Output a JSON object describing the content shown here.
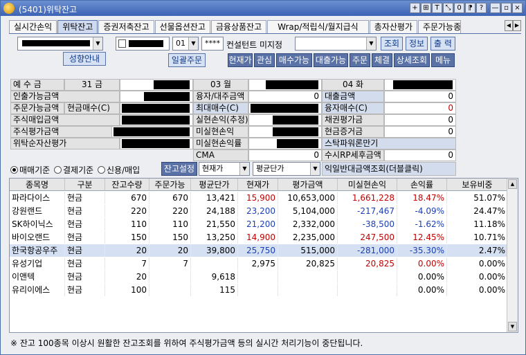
{
  "window": {
    "title": "(5401)위탁잔고",
    "title_buttons": [
      "+",
      "⊞",
      "T",
      "⤡",
      "0",
      "⁋",
      "?",
      "—",
      "▫",
      "×"
    ]
  },
  "tabs": [
    "실시간손익",
    "위탁잔고",
    "증권저축잔고",
    "선물옵션잔고",
    "금융상품잔고",
    "Wrap/적립식/월지급식",
    "총자산평가",
    "주문가능종합"
  ],
  "tab_nav": {
    "prev": "◀",
    "next": "▶"
  },
  "toolbar": {
    "account_suffix": "01",
    "password_mask": "****",
    "consultant_label": "컨설턴트 미지정",
    "query": "조회",
    "info": "정보",
    "print": "출 력",
    "propensity": "성향안내",
    "batch_order": "일괄주문",
    "current_price": "현재가",
    "interest": "관심",
    "buy_possible": "매수가능",
    "loan_possible": "대출가능",
    "order": "주문",
    "execution": "체결",
    "detail_query": "상세조회",
    "menu": "메뉴"
  },
  "dates": {
    "deposit_label": "예 수 금",
    "d0": "31 금",
    "d1": "03 월",
    "d2": "04 화"
  },
  "summary": {
    "rows": [
      {
        "l1": "인출가능금액",
        "l2": "융자/대주금액",
        "v2": "0",
        "l3": "대출금액",
        "v3": "0"
      },
      {
        "l1": "주문가능금액",
        "l1b": "현금매수(C)",
        "l2": "최대매수(C)",
        "l3": "융자매수(C)",
        "v3": "0"
      },
      {
        "l1": "주식매입금액",
        "l2": "실현손익(추정)",
        "l3": "채권평가금",
        "v3": "0"
      },
      {
        "l1": "주식평가금액",
        "l2": "미실현손익",
        "l3": "현금증거금",
        "v3": "0"
      },
      {
        "l1": "위탁순자산평가",
        "l2": "미실현손익률",
        "l3": "스탁파워론만기"
      },
      {
        "l2": "CMA",
        "v2": "0",
        "l3": "수시RP세후금액",
        "v3": "0"
      }
    ]
  },
  "options": {
    "radio_buy": "매매기준",
    "radio_settle": "결제기준",
    "radio_credit": "신용/매입",
    "balance_setting": "잔고설정",
    "price_select": "현재가",
    "avg_select": "평균단가",
    "pnl_note": "익일반대금액조회(더블클릭)"
  },
  "table": {
    "headers": [
      "종목명",
      "구분",
      "잔고수량",
      "주문가능",
      "평균단가",
      "현재가",
      "평가금액",
      "미실현손익",
      "손익률",
      "보유비중"
    ],
    "rows": [
      [
        "파라다이스",
        "현금",
        "670",
        "670",
        "13,421",
        "15,900",
        "10,653,000",
        "1,661,228",
        "18.47%",
        "51.07%"
      ],
      [
        "강원랜드",
        "현금",
        "220",
        "220",
        "24,188",
        "23,200",
        "5,104,000",
        "-217,467",
        "-4.09%",
        "24.47%"
      ],
      [
        "SK하이닉스",
        "현금",
        "110",
        "110",
        "21,550",
        "21,200",
        "2,332,000",
        "-38,500",
        "-1.62%",
        "11.18%"
      ],
      [
        "바이오랜드",
        "현금",
        "150",
        "150",
        "13,250",
        "14,900",
        "2,235,000",
        "247,500",
        "12.45%",
        "10.71%"
      ],
      [
        "한국항공우주",
        "현금",
        "20",
        "20",
        "39,800",
        "25,750",
        "515,000",
        "-281,000",
        "-35.30%",
        "2.47%"
      ],
      [
        "유성기업",
        "현금",
        "7",
        "7",
        "",
        "2,975",
        "20,825",
        "20,825",
        "0.00%",
        "0.00%"
      ],
      [
        "이앤텍",
        "현금",
        "20",
        "",
        "9,618",
        "",
        "",
        "",
        "0.00%",
        "0.00%"
      ],
      [
        "유리이에스",
        "현금",
        "100",
        "",
        "115",
        "",
        "",
        "",
        "0.00%",
        "0.00%"
      ]
    ],
    "colors": {
      "up": "#c00000",
      "down": "#1a3fb5",
      "neutral": "#000000"
    }
  },
  "footer": "※ 잔고 100종목 이상시 원활한 잔고조회를 위하여 주식평가금액 등의 실시간 처리기능이 중단됩니다."
}
